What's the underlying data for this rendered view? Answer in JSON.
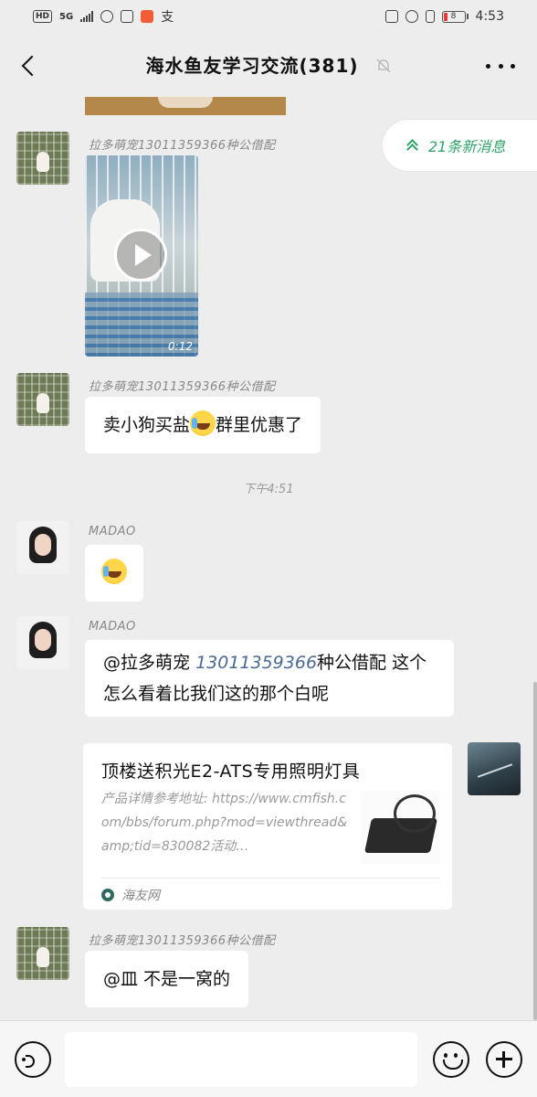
{
  "status_bar": {
    "hd": "HD",
    "network": "5G",
    "extra_icon": "支",
    "battery": "8",
    "time": "4:53"
  },
  "header": {
    "title": "海水鱼友学习交流(381)",
    "back_icon": "chevron-left-icon",
    "mute_icon": "bell-off-icon",
    "more_icon": "more-horizontal-icon"
  },
  "new_messages": {
    "label": "21条新消息",
    "icon": "double-chevron-up-icon"
  },
  "messages": [
    {
      "sender": "拉多萌宠13011359366种公借配",
      "type": "video",
      "duration": "0:12"
    },
    {
      "sender": "拉多萌宠13011359366种公借配",
      "type": "text",
      "text_before": "卖小狗买盐",
      "text_after": "群里优惠了",
      "emoji": "laugh-cry-emoji"
    },
    {
      "sender": "MADAO",
      "type": "emoji",
      "emoji": "laugh-cry-emoji"
    },
    {
      "sender": "MADAO",
      "type": "text",
      "mention": "@拉多萌宠",
      "phone": "13011359366",
      "text_after": "种公借配  这个怎么看着比我们这的那个白呢"
    },
    {
      "type": "link_card",
      "title": "顶楼送积光E2-ATS专用照明灯具",
      "description": "产品详情参考地址: https://www.cmfish.com/bbs/forum.php?mod=viewthread&amp;tid=830082活动…",
      "source": "海友网"
    },
    {
      "sender": "拉多萌宠13011359366种公借配",
      "type": "text",
      "text": "@皿 不是一窝的"
    }
  ],
  "time_separator": "下午4:51",
  "input_bar": {
    "voice_icon": "voice-icon",
    "emoji_icon": "smile-icon",
    "plus_icon": "plus-icon",
    "placeholder": ""
  }
}
